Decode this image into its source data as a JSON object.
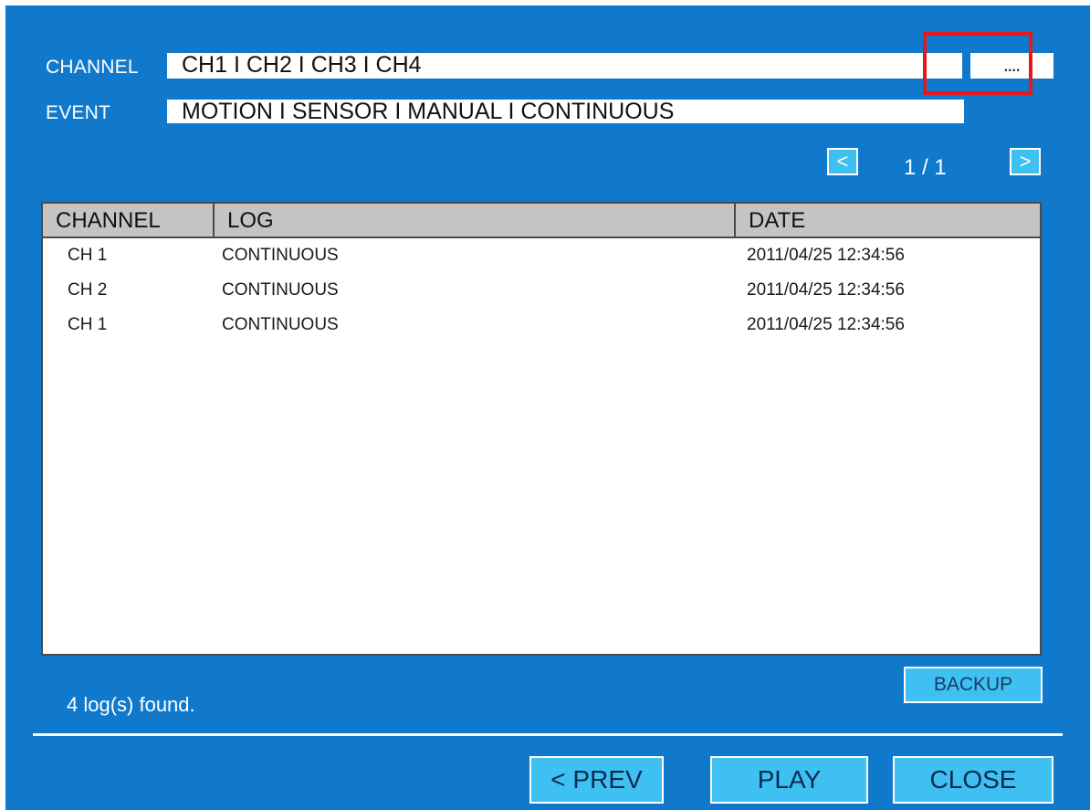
{
  "filters": {
    "channel_label": "CHANNEL",
    "channel_value": "CH1 I CH2 I  CH3 I CH4",
    "event_label": "EVENT",
    "event_value": "MOTION I SENSOR I  MANUAL I CONTINUOUS",
    "more_button": "...."
  },
  "pagination": {
    "prev": "<",
    "indicator": "1 / 1",
    "next": ">"
  },
  "table": {
    "headers": [
      "CHANNEL",
      "LOG",
      "DATE"
    ],
    "rows": [
      {
        "channel": "CH 1",
        "log": "CONTINUOUS",
        "date": "2011/04/25  12:34:56"
      },
      {
        "channel": "CH 2",
        "log": "CONTINUOUS",
        "date": "2011/04/25  12:34:56"
      },
      {
        "channel": "CH 1",
        "log": "CONTINUOUS",
        "date": "2011/04/25  12:34:56"
      }
    ]
  },
  "status": "4 log(s) found.",
  "buttons": {
    "backup": "BACKUP",
    "prev": "< PREV",
    "play": "PLAY",
    "close": "CLOSE"
  },
  "colors": {
    "panel": "#1179cc",
    "button": "#3fc0f2",
    "header_bg": "#c4c4c4",
    "highlight": "#e8171c"
  }
}
